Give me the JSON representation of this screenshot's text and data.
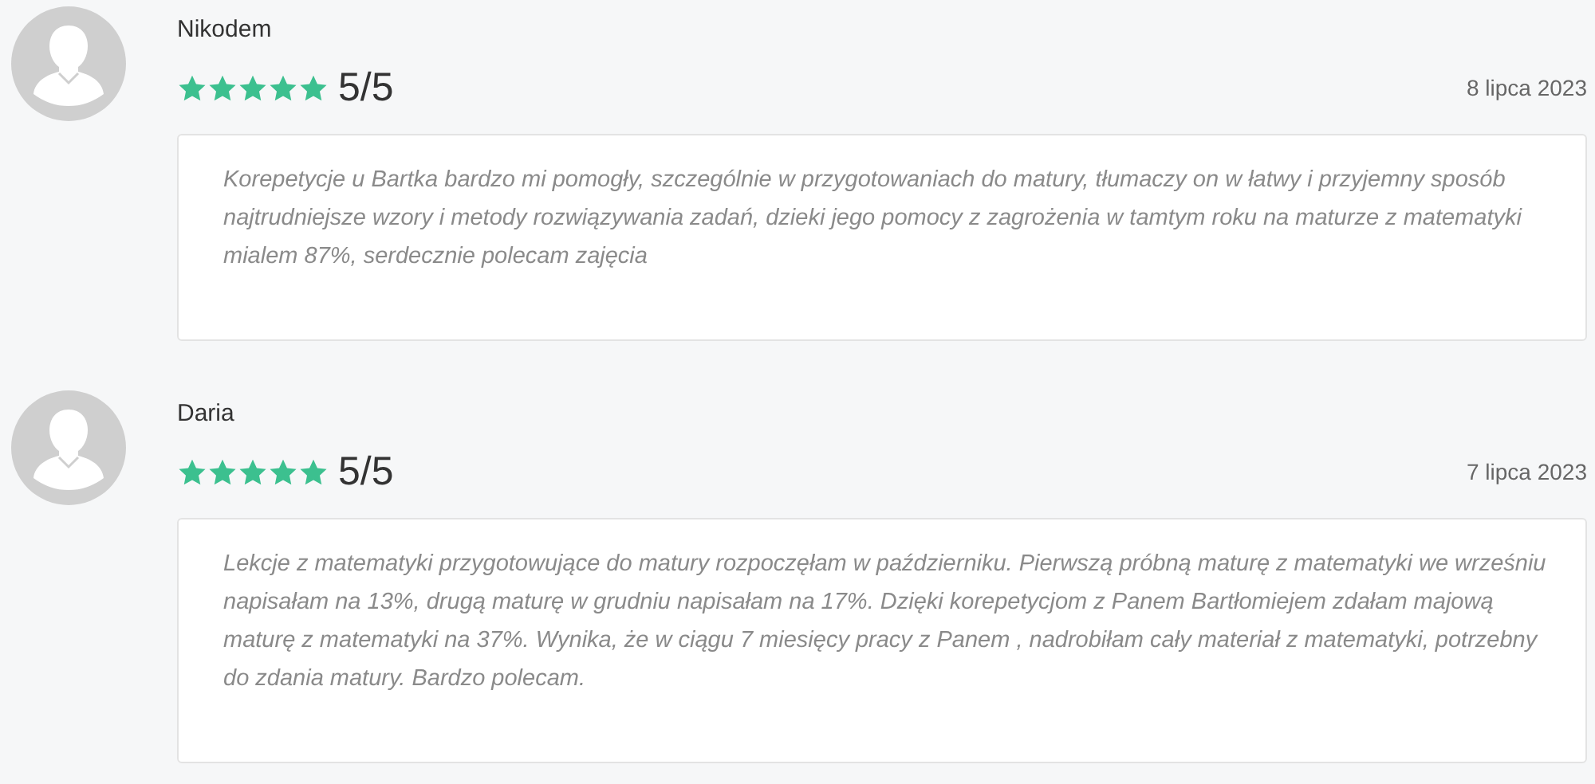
{
  "reviews": [
    {
      "author": "Nikodem",
      "stars": 5,
      "rating": "5/5",
      "date": "8 lipca 2023",
      "text": "Korepetycje u Bartka bardzo mi pomogły, szczególnie w przygotowaniach do matury, tłumaczy on w łatwy i przyjemny sposób najtrudniejsze wzory i metody rozwiązywania zadań, dzieki jego pomocy z zagrożenia w tamtym roku na maturze z matematyki mialem 87%, serdecznie polecam zajęcia"
    },
    {
      "author": "Daria",
      "stars": 5,
      "rating": "5/5",
      "date": "7 lipca 2023",
      "text": "Lekcje z matematyki przygotowujące do matury rozpoczęłam w październiku. Pierwszą próbną maturę z matematyki we wrześniu napisałam na 13%, drugą maturę w grudniu napisałam na 17%. Dzięki korepetycjom z Panem Bartłomiejem zdałam majową maturę z matematyki na 37%. Wynika, że w ciągu 7 miesięcy pracy z Panem , nadrobiłam cały materiał z matematyki, potrzebny do zdania matury. Bardzo polecam."
    }
  ]
}
